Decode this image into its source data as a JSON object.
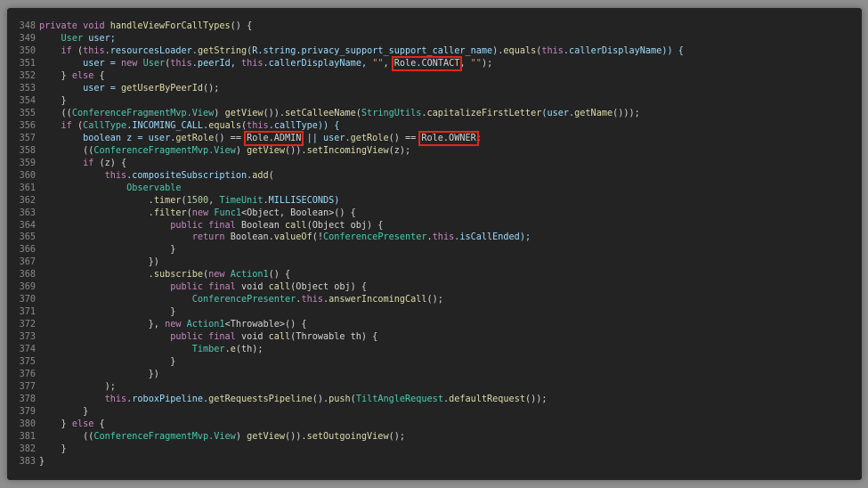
{
  "editor": {
    "lines": [
      {
        "n": "348",
        "tokens": [
          {
            "t": "private void ",
            "c": "kw"
          },
          {
            "t": "handleViewForCallTypes",
            "c": "fn"
          },
          {
            "t": "() {",
            "c": "plain"
          }
        ]
      },
      {
        "n": "349",
        "tokens": [
          {
            "t": "    ",
            "c": "plain"
          },
          {
            "t": "User",
            "c": "ty"
          },
          {
            "t": " user;",
            "c": "var"
          }
        ]
      },
      {
        "n": "350",
        "tokens": [
          {
            "t": "    ",
            "c": "plain"
          },
          {
            "t": "if",
            "c": "kw"
          },
          {
            "t": " (",
            "c": "plain"
          },
          {
            "t": "this",
            "c": "kw"
          },
          {
            "t": ".resourcesLoader.",
            "c": "var"
          },
          {
            "t": "getString",
            "c": "fn"
          },
          {
            "t": "(R.string.privacy_support_support_caller_name).",
            "c": "var"
          },
          {
            "t": "equals",
            "c": "fn"
          },
          {
            "t": "(",
            "c": "plain"
          },
          {
            "t": "this",
            "c": "kw"
          },
          {
            "t": ".callerDisplayName)) {",
            "c": "var"
          }
        ]
      },
      {
        "n": "351",
        "tokens": [
          {
            "t": "        user = ",
            "c": "var"
          },
          {
            "t": "new",
            "c": "kw"
          },
          {
            "t": " ",
            "c": "plain"
          },
          {
            "t": "User",
            "c": "ty"
          },
          {
            "t": "(",
            "c": "plain"
          },
          {
            "t": "this",
            "c": "kw"
          },
          {
            "t": ".peerId, ",
            "c": "var"
          },
          {
            "t": "this",
            "c": "kw"
          },
          {
            "t": ".callerDisplayName, ",
            "c": "var"
          },
          {
            "t": "\"\"",
            "c": "str"
          },
          {
            "t": ", ",
            "c": "plain"
          },
          {
            "t": "Role.CONTACT",
            "c": "hl"
          },
          {
            "t": ", ",
            "c": "plain"
          },
          {
            "t": "\"\"",
            "c": "str"
          },
          {
            "t": ");",
            "c": "plain"
          }
        ]
      },
      {
        "n": "352",
        "tokens": [
          {
            "t": "    } ",
            "c": "plain"
          },
          {
            "t": "else",
            "c": "kw"
          },
          {
            "t": " {",
            "c": "plain"
          }
        ]
      },
      {
        "n": "353",
        "tokens": [
          {
            "t": "        user = ",
            "c": "var"
          },
          {
            "t": "getUserByPeerId",
            "c": "fn"
          },
          {
            "t": "();",
            "c": "plain"
          }
        ]
      },
      {
        "n": "354",
        "tokens": [
          {
            "t": "    }",
            "c": "plain"
          }
        ]
      },
      {
        "n": "355",
        "tokens": [
          {
            "t": "    ((",
            "c": "plain"
          },
          {
            "t": "ConferenceFragmentMvp.View",
            "c": "ty"
          },
          {
            "t": ") ",
            "c": "plain"
          },
          {
            "t": "getView",
            "c": "fn"
          },
          {
            "t": "()).",
            "c": "plain"
          },
          {
            "t": "setCalleeName",
            "c": "fn"
          },
          {
            "t": "(",
            "c": "plain"
          },
          {
            "t": "StringUtils",
            "c": "ty"
          },
          {
            "t": ".",
            "c": "plain"
          },
          {
            "t": "capitalizeFirstLetter",
            "c": "fn"
          },
          {
            "t": "(user.",
            "c": "var"
          },
          {
            "t": "getName",
            "c": "fn"
          },
          {
            "t": "()));",
            "c": "plain"
          }
        ]
      },
      {
        "n": "356",
        "tokens": [
          {
            "t": "    ",
            "c": "plain"
          },
          {
            "t": "if",
            "c": "kw"
          },
          {
            "t": " (",
            "c": "plain"
          },
          {
            "t": "CallType",
            "c": "ty"
          },
          {
            "t": ".INCOMING_CALL.",
            "c": "var"
          },
          {
            "t": "equals",
            "c": "fn"
          },
          {
            "t": "(",
            "c": "plain"
          },
          {
            "t": "this",
            "c": "kw"
          },
          {
            "t": ".callType)) {",
            "c": "var"
          }
        ]
      },
      {
        "n": "357",
        "tokens": [
          {
            "t": "        boolean z = user.",
            "c": "var"
          },
          {
            "t": "getRole",
            "c": "fn"
          },
          {
            "t": "() == ",
            "c": "plain"
          },
          {
            "t": "Role.ADMIN",
            "c": "hl"
          },
          {
            "t": " || user.",
            "c": "var"
          },
          {
            "t": "getRole",
            "c": "fn"
          },
          {
            "t": "() == ",
            "c": "plain"
          },
          {
            "t": "Role.OWNER",
            "c": "hl"
          },
          {
            "t": ";",
            "c": "plain"
          }
        ]
      },
      {
        "n": "358",
        "tokens": [
          {
            "t": "        ((",
            "c": "plain"
          },
          {
            "t": "ConferenceFragmentMvp.View",
            "c": "ty"
          },
          {
            "t": ") ",
            "c": "plain"
          },
          {
            "t": "getView",
            "c": "fn"
          },
          {
            "t": "()).",
            "c": "plain"
          },
          {
            "t": "setIncomingView",
            "c": "fn"
          },
          {
            "t": "(z);",
            "c": "plain"
          }
        ]
      },
      {
        "n": "359",
        "tokens": [
          {
            "t": "        ",
            "c": "plain"
          },
          {
            "t": "if",
            "c": "kw"
          },
          {
            "t": " (z) {",
            "c": "plain"
          }
        ]
      },
      {
        "n": "360",
        "tokens": [
          {
            "t": "            ",
            "c": "plain"
          },
          {
            "t": "this",
            "c": "kw"
          },
          {
            "t": ".compositeSubscription.",
            "c": "var"
          },
          {
            "t": "add",
            "c": "fn"
          },
          {
            "t": "(",
            "c": "plain"
          }
        ]
      },
      {
        "n": "361",
        "tokens": [
          {
            "t": "                ",
            "c": "plain"
          },
          {
            "t": "Observable",
            "c": "ty"
          }
        ]
      },
      {
        "n": "362",
        "tokens": [
          {
            "t": "                    .",
            "c": "plain"
          },
          {
            "t": "timer",
            "c": "fn"
          },
          {
            "t": "(",
            "c": "plain"
          },
          {
            "t": "1500",
            "c": "num"
          },
          {
            "t": ", ",
            "c": "plain"
          },
          {
            "t": "TimeUnit",
            "c": "ty"
          },
          {
            "t": ".MILLISECONDS)",
            "c": "var"
          }
        ]
      },
      {
        "n": "363",
        "tokens": [
          {
            "t": "                    .",
            "c": "plain"
          },
          {
            "t": "filter",
            "c": "fn"
          },
          {
            "t": "(",
            "c": "plain"
          },
          {
            "t": "new",
            "c": "kw"
          },
          {
            "t": " ",
            "c": "plain"
          },
          {
            "t": "Func1",
            "c": "ty"
          },
          {
            "t": "<Object, Boolean>() {",
            "c": "plain"
          }
        ]
      },
      {
        "n": "364",
        "tokens": [
          {
            "t": "                        ",
            "c": "plain"
          },
          {
            "t": "public final",
            "c": "kw"
          },
          {
            "t": " Boolean ",
            "c": "plain"
          },
          {
            "t": "call",
            "c": "fn"
          },
          {
            "t": "(Object obj) {",
            "c": "plain"
          }
        ]
      },
      {
        "n": "365",
        "tokens": [
          {
            "t": "                            ",
            "c": "plain"
          },
          {
            "t": "return",
            "c": "kw"
          },
          {
            "t": " Boolean.",
            "c": "plain"
          },
          {
            "t": "valueOf",
            "c": "fn"
          },
          {
            "t": "(!",
            "c": "plain"
          },
          {
            "t": "ConferencePresenter",
            "c": "ty"
          },
          {
            "t": ".",
            "c": "plain"
          },
          {
            "t": "this",
            "c": "kw"
          },
          {
            "t": ".isCallEnded);",
            "c": "var"
          }
        ]
      },
      {
        "n": "366",
        "tokens": [
          {
            "t": "                        }",
            "c": "plain"
          }
        ]
      },
      {
        "n": "367",
        "tokens": [
          {
            "t": "                    })",
            "c": "plain"
          }
        ]
      },
      {
        "n": "368",
        "tokens": [
          {
            "t": "                    .",
            "c": "plain"
          },
          {
            "t": "subscribe",
            "c": "fn"
          },
          {
            "t": "(",
            "c": "plain"
          },
          {
            "t": "new",
            "c": "kw"
          },
          {
            "t": " ",
            "c": "plain"
          },
          {
            "t": "Action1",
            "c": "ty"
          },
          {
            "t": "() {",
            "c": "plain"
          }
        ]
      },
      {
        "n": "369",
        "tokens": [
          {
            "t": "                        ",
            "c": "plain"
          },
          {
            "t": "public final",
            "c": "kw"
          },
          {
            "t": " void ",
            "c": "plain"
          },
          {
            "t": "call",
            "c": "fn"
          },
          {
            "t": "(Object obj) {",
            "c": "plain"
          }
        ]
      },
      {
        "n": "370",
        "tokens": [
          {
            "t": "                            ",
            "c": "plain"
          },
          {
            "t": "ConferencePresenter",
            "c": "ty"
          },
          {
            "t": ".",
            "c": "plain"
          },
          {
            "t": "this",
            "c": "kw"
          },
          {
            "t": ".",
            "c": "plain"
          },
          {
            "t": "answerIncomingCall",
            "c": "fn"
          },
          {
            "t": "();",
            "c": "plain"
          }
        ]
      },
      {
        "n": "371",
        "tokens": [
          {
            "t": "                        }",
            "c": "plain"
          }
        ]
      },
      {
        "n": "372",
        "tokens": [
          {
            "t": "                    }, ",
            "c": "plain"
          },
          {
            "t": "new",
            "c": "kw"
          },
          {
            "t": " ",
            "c": "plain"
          },
          {
            "t": "Action1",
            "c": "ty"
          },
          {
            "t": "<Throwable>() {",
            "c": "plain"
          }
        ]
      },
      {
        "n": "373",
        "tokens": [
          {
            "t": "                        ",
            "c": "plain"
          },
          {
            "t": "public final",
            "c": "kw"
          },
          {
            "t": " void ",
            "c": "plain"
          },
          {
            "t": "call",
            "c": "fn"
          },
          {
            "t": "(Throwable th) {",
            "c": "plain"
          }
        ]
      },
      {
        "n": "374",
        "tokens": [
          {
            "t": "                            ",
            "c": "plain"
          },
          {
            "t": "Timber",
            "c": "ty"
          },
          {
            "t": ".",
            "c": "plain"
          },
          {
            "t": "e",
            "c": "fn"
          },
          {
            "t": "(th);",
            "c": "plain"
          }
        ]
      },
      {
        "n": "375",
        "tokens": [
          {
            "t": "                        }",
            "c": "plain"
          }
        ]
      },
      {
        "n": "376",
        "tokens": [
          {
            "t": "                    })",
            "c": "plain"
          }
        ]
      },
      {
        "n": "377",
        "tokens": [
          {
            "t": "            );",
            "c": "plain"
          }
        ]
      },
      {
        "n": "378",
        "tokens": [
          {
            "t": "            ",
            "c": "plain"
          },
          {
            "t": "this",
            "c": "kw"
          },
          {
            "t": ".roboxPipeline.",
            "c": "var"
          },
          {
            "t": "getRequestsPipeline",
            "c": "fn"
          },
          {
            "t": "().",
            "c": "plain"
          },
          {
            "t": "push",
            "c": "fn"
          },
          {
            "t": "(",
            "c": "plain"
          },
          {
            "t": "TiltAngleRequest",
            "c": "ty"
          },
          {
            "t": ".",
            "c": "plain"
          },
          {
            "t": "defaultRequest",
            "c": "fn"
          },
          {
            "t": "());",
            "c": "plain"
          }
        ]
      },
      {
        "n": "379",
        "tokens": [
          {
            "t": "        }",
            "c": "plain"
          }
        ]
      },
      {
        "n": "380",
        "tokens": [
          {
            "t": "    } ",
            "c": "plain"
          },
          {
            "t": "else",
            "c": "kw"
          },
          {
            "t": " {",
            "c": "plain"
          }
        ]
      },
      {
        "n": "381",
        "tokens": [
          {
            "t": "        ((",
            "c": "plain"
          },
          {
            "t": "ConferenceFragmentMvp.View",
            "c": "ty"
          },
          {
            "t": ") ",
            "c": "plain"
          },
          {
            "t": "getView",
            "c": "fn"
          },
          {
            "t": "()).",
            "c": "plain"
          },
          {
            "t": "setOutgoingView",
            "c": "fn"
          },
          {
            "t": "();",
            "c": "plain"
          }
        ]
      },
      {
        "n": "382",
        "tokens": [
          {
            "t": "    }",
            "c": "plain"
          }
        ]
      },
      {
        "n": "383",
        "tokens": [
          {
            "t": "}",
            "c": "plain"
          }
        ]
      }
    ]
  },
  "colors": {
    "background": "#232323",
    "highlight_box": "#e3261c"
  }
}
